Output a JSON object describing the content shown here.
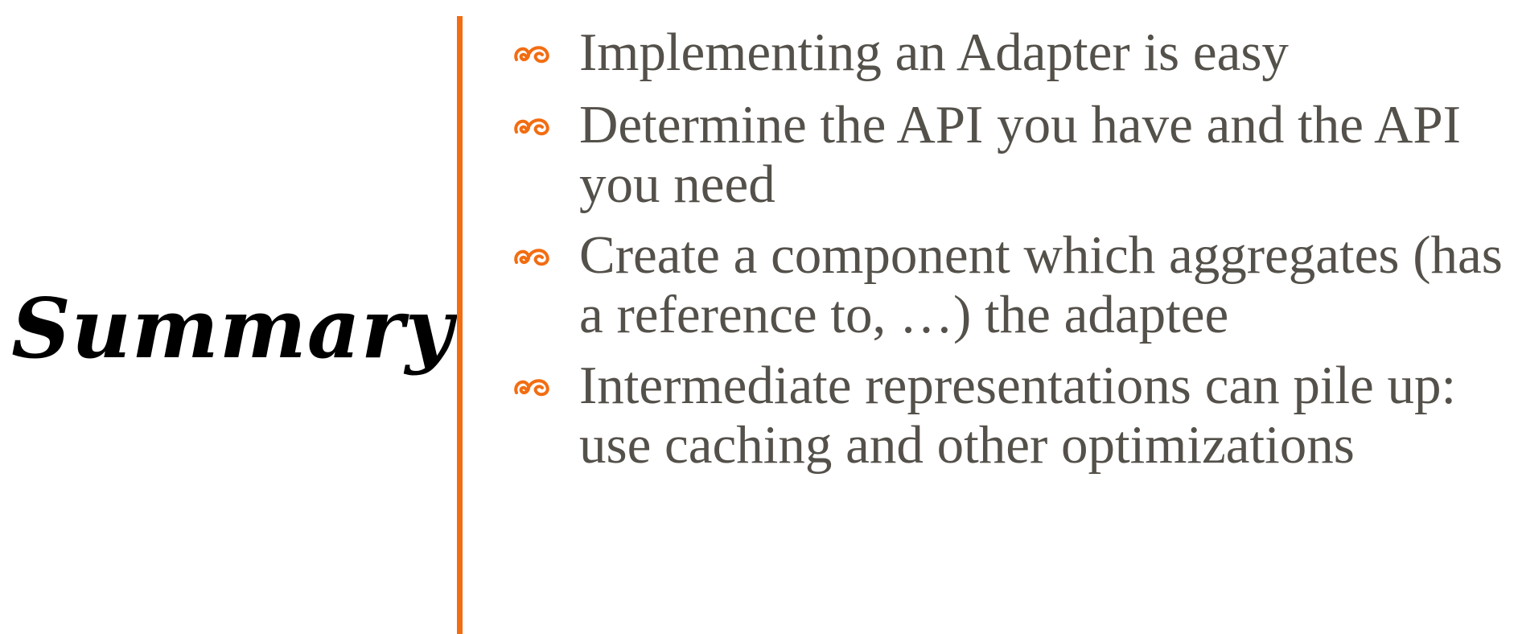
{
  "slide": {
    "title": "Summary",
    "bullets": [
      {
        "text": "Implementing an Adapter is easy"
      },
      {
        "text": "Determine the API you have and the API you need"
      },
      {
        "text": "Create a component which aggregates (has a reference to, …) the adaptee"
      },
      {
        "text": "Intermediate representations can pile up: use caching and other optimizations"
      }
    ]
  },
  "icons": {
    "bullet": "fleuron-icon"
  },
  "colors": {
    "accent": "#F26D12",
    "body_text": "#54504a",
    "title_text": "#000000",
    "background": "#ffffff"
  }
}
